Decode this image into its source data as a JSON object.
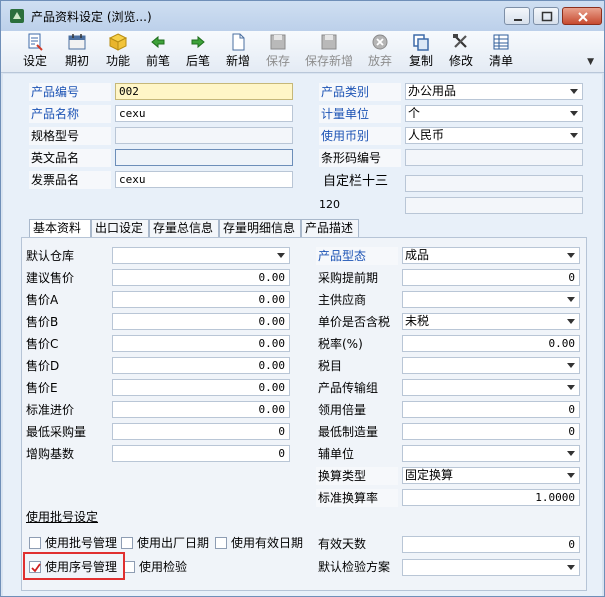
{
  "window": {
    "title": "产品资料设定 (浏览...)",
    "accent": "#1d54b5"
  },
  "toolbar": {
    "items": [
      {
        "label": "设定",
        "icon": "setting-icon",
        "enabled": true
      },
      {
        "label": "期初",
        "icon": "opening-icon",
        "enabled": true
      },
      {
        "label": "功能",
        "icon": "function-icon",
        "enabled": true
      },
      {
        "label": "前笔",
        "icon": "arrow-left-icon",
        "enabled": true
      },
      {
        "label": "后笔",
        "icon": "arrow-right-icon",
        "enabled": true
      },
      {
        "label": "新增",
        "icon": "new-document-icon",
        "enabled": true
      },
      {
        "label": "保存",
        "icon": "save-icon",
        "enabled": false
      },
      {
        "label": "保存新增",
        "icon": "save-new-icon",
        "enabled": false
      },
      {
        "label": "放弃",
        "icon": "discard-icon",
        "enabled": false
      },
      {
        "label": "复制",
        "icon": "copy-icon",
        "enabled": true
      },
      {
        "label": "修改",
        "icon": "edit-icon",
        "enabled": true
      },
      {
        "label": "清单",
        "icon": "list-icon",
        "enabled": true
      }
    ]
  },
  "header": {
    "product_code_label": "产品编号",
    "product_code_value": "002",
    "product_name_label": "产品名称",
    "product_name_value": "cexu",
    "spec_label": "规格型号",
    "spec_value": "",
    "english_name_label": "英文品名",
    "english_name_value": "",
    "invoice_name_label": "发票品名",
    "invoice_name_value": "cexu",
    "category_label": "产品类别",
    "category_value": "办公用品",
    "unit_label": "计量单位",
    "unit_value": "个",
    "currency_label": "使用币别",
    "currency_value": "人民币",
    "barcode_label": "条形码编号",
    "barcode_value": "",
    "extra_label": "自定栏十三",
    "extra_value": "",
    "extra2_label": "120",
    "extra2_value": ""
  },
  "tabs": [
    "基本资料",
    "出口设定",
    "存量总信息",
    "存量明细信息",
    "产品描述"
  ],
  "basic": {
    "left": [
      {
        "label": "默认仓库",
        "value": "",
        "kind": "select"
      },
      {
        "label": "建议售价",
        "value": "0.00",
        "kind": "number"
      },
      {
        "label": "售价A",
        "value": "0.00",
        "kind": "number"
      },
      {
        "label": "售价B",
        "value": "0.00",
        "kind": "number"
      },
      {
        "label": "售价C",
        "value": "0.00",
        "kind": "number"
      },
      {
        "label": "售价D",
        "value": "0.00",
        "kind": "number"
      },
      {
        "label": "售价E",
        "value": "0.00",
        "kind": "number"
      },
      {
        "label": "标准进价",
        "value": "0.00",
        "kind": "number"
      },
      {
        "label": "最低采购量",
        "value": "0",
        "kind": "number"
      },
      {
        "label": "增购基数",
        "value": "0",
        "kind": "number"
      }
    ],
    "right": [
      {
        "label": "产品型态",
        "value": "成品",
        "kind": "select",
        "required": true
      },
      {
        "label": "采购提前期",
        "value": "0",
        "kind": "number"
      },
      {
        "label": "主供应商",
        "value": "",
        "kind": "select"
      },
      {
        "label": "单价是否含税",
        "value": "未税",
        "kind": "select"
      },
      {
        "label": "税率(%)",
        "value": "0.00",
        "kind": "number"
      },
      {
        "label": "税目",
        "value": "",
        "kind": "select"
      },
      {
        "label": "产品传输组",
        "value": "",
        "kind": "select"
      },
      {
        "label": "领用倍量",
        "value": "0",
        "kind": "number"
      },
      {
        "label": "最低制造量",
        "value": "0",
        "kind": "number"
      },
      {
        "label": "辅单位",
        "value": "",
        "kind": "select"
      },
      {
        "label": "换算类型",
        "value": "固定换算",
        "kind": "select"
      },
      {
        "label": "标准换算率",
        "value": "1.0000",
        "kind": "number"
      }
    ],
    "batch_section_title": "使用批号设定",
    "checkboxes": [
      {
        "label": "使用批号管理",
        "checked": false
      },
      {
        "label": "使用出厂日期",
        "checked": false
      },
      {
        "label": "使用有效日期",
        "checked": false
      },
      {
        "label": "使用序号管理",
        "checked": true
      },
      {
        "label": "使用检验",
        "checked": false
      }
    ],
    "valid_days_label": "有效天数",
    "valid_days_value": "0",
    "default_inspection_label": "默认检验方案",
    "default_inspection_value": ""
  }
}
